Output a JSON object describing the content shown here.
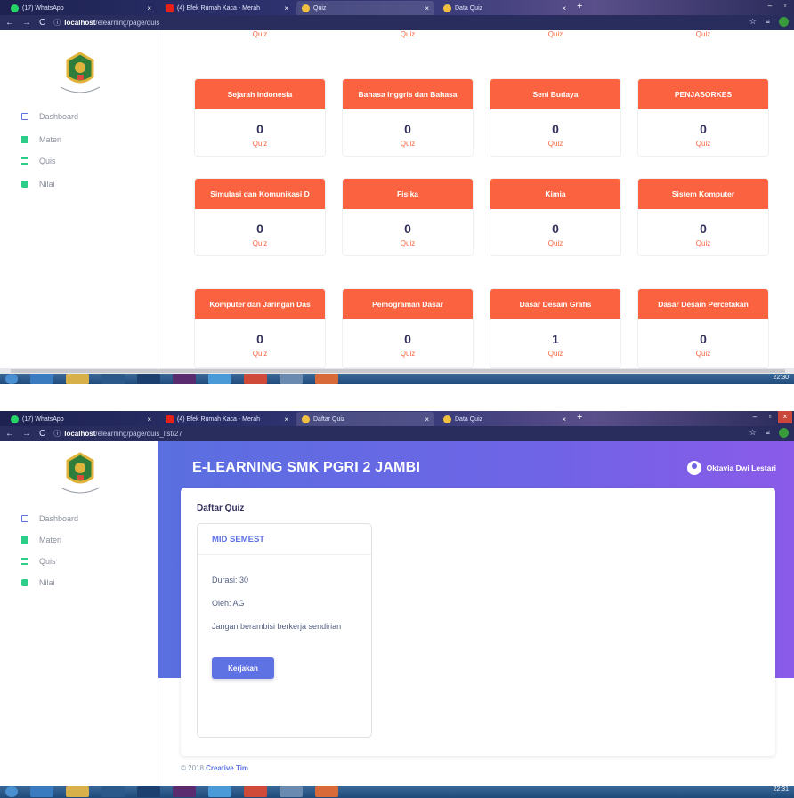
{
  "colors": {
    "accent": "#fb6340",
    "primary": "#5e72e4",
    "header_gradient": [
      "#5a6fe0",
      "#8a5be8"
    ]
  },
  "screens": [
    {
      "browser": {
        "tabs": [
          {
            "label": "(17) WhatsApp",
            "icon": "whatsapp-icon"
          },
          {
            "label": "(4) Efek Rumah Kaca - Merah",
            "icon": "youtube-icon"
          },
          {
            "label": "Quiz",
            "icon": "page-icon",
            "active": true
          },
          {
            "label": "Data Quiz",
            "icon": "page-icon"
          }
        ],
        "url_host": "localhost",
        "url_path": "/elearning/page/quis"
      },
      "sidebar": {
        "items": [
          {
            "label": "Dashboard",
            "icon": "monitor-icon"
          },
          {
            "label": "Materi",
            "icon": "book-icon"
          },
          {
            "label": "Quis",
            "icon": "list-icon"
          },
          {
            "label": "Nilai",
            "icon": "bag-icon"
          }
        ]
      },
      "top_row_labels": [
        "Quiz",
        "Quiz",
        "Quiz",
        "Quiz"
      ],
      "cards": [
        {
          "title": "Sejarah Indonesia",
          "count": "0",
          "label": "Quiz"
        },
        {
          "title": "Bahasa Inggris dan Bahasa",
          "count": "0",
          "label": "Quiz"
        },
        {
          "title": "Seni Budaya",
          "count": "0",
          "label": "Quiz"
        },
        {
          "title": "PENJASORKES",
          "count": "0",
          "label": "Quiz"
        },
        {
          "title": "Simulasi dan Komunikasi D",
          "count": "0",
          "label": "Quiz"
        },
        {
          "title": "Fisika",
          "count": "0",
          "label": "Quiz"
        },
        {
          "title": "Kimia",
          "count": "0",
          "label": "Quiz"
        },
        {
          "title": "Sistem Komputer",
          "count": "0",
          "label": "Quiz"
        },
        {
          "title": "Komputer dan Jaringan Das",
          "count": "0",
          "label": "Quiz"
        },
        {
          "title": "Pemograman Dasar",
          "count": "0",
          "label": "Quiz"
        },
        {
          "title": "Dasar Desain Grafis",
          "count": "1",
          "label": "Quiz"
        },
        {
          "title": "Dasar Desain Percetakan",
          "count": "0",
          "label": "Quiz"
        }
      ],
      "taskbar_time": "22:30"
    },
    {
      "browser": {
        "tabs": [
          {
            "label": "(17) WhatsApp",
            "icon": "whatsapp-icon"
          },
          {
            "label": "(4) Efek Rumah Kaca - Merah",
            "icon": "youtube-icon"
          },
          {
            "label": "Daftar Quiz",
            "icon": "page-icon",
            "active": true
          },
          {
            "label": "Data Quiz",
            "icon": "page-icon"
          }
        ],
        "url_host": "localhost",
        "url_path": "/elearning/page/quis_list/27"
      },
      "sidebar": {
        "items": [
          {
            "label": "Dashboard",
            "icon": "monitor-icon"
          },
          {
            "label": "Materi",
            "icon": "book-icon"
          },
          {
            "label": "Quis",
            "icon": "list-icon"
          },
          {
            "label": "Nilai",
            "icon": "bag-icon"
          }
        ]
      },
      "header": {
        "title": "E-LEARNING SMK PGRI 2 JAMBI",
        "user_name": "Oktavia Dwi Lestari"
      },
      "panel": {
        "title": "Daftar Quiz",
        "quiz": {
          "name": "MID SEMEST",
          "duration": "Durasi: 30",
          "author": "Oleh: AG",
          "description": "Jangan berambisi berkerja sendirian",
          "button": "Kerjakan"
        }
      },
      "footer": {
        "text": "© 2018",
        "brand": "Creative Tim"
      },
      "taskbar_time": "22:31"
    }
  ]
}
